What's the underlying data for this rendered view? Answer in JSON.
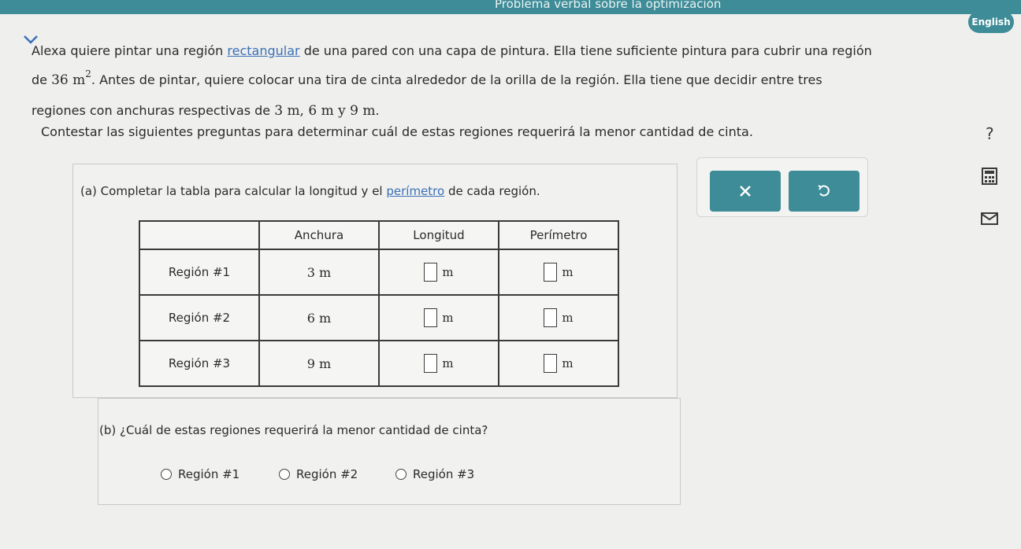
{
  "header": {
    "title": "Problema verbal sobre la optimización",
    "language_button": "English"
  },
  "problem": {
    "text1": "Alexa quiere pintar una región ",
    "link_rectangular": "rectangular",
    "text2": " de una pared con una capa de pintura. Ella tiene suficiente pintura para cubrir una región",
    "text3": "de ",
    "area_value": "36 m",
    "area_exponent": "2",
    "text4": ". Antes de pintar, quiere colocar una tira de cinta alrededor de la orilla de la región. Ella tiene que decidir entre tres",
    "text5": "regiones con anchuras respectivas de ",
    "widths": "3 m, 6 m y 9 m",
    "text6": "."
  },
  "instruction": "Contestar las siguientes preguntas para determinar cuál de estas regiones requerirá la menor cantidad de cinta.",
  "part_a": {
    "prefix": "(a) Completar la tabla para calcular la longitud y el ",
    "link_perimetro": "perímetro",
    "suffix": " de cada región."
  },
  "table": {
    "headers": [
      "",
      "Anchura",
      "Longitud",
      "Perímetro"
    ],
    "rows": [
      {
        "label": "Región #1",
        "width": "3 m",
        "length_unit": "m",
        "perimeter_unit": "m"
      },
      {
        "label": "Región #2",
        "width": "6 m",
        "length_unit": "m",
        "perimeter_unit": "m"
      },
      {
        "label": "Región #3",
        "width": "9 m",
        "length_unit": "m",
        "perimeter_unit": "m"
      }
    ]
  },
  "part_b": {
    "question": "(b) ¿Cuál de estas regiones requerirá la menor cantidad de cinta?",
    "options": [
      "Región #1",
      "Región #2",
      "Región #3"
    ]
  },
  "tools": {
    "clear_icon": "x-icon",
    "undo_icon": "undo-icon"
  },
  "icons": {
    "help": "?",
    "calculator": "calculator-icon",
    "mail": "envelope-icon"
  },
  "colors": {
    "accent": "#3e8c97",
    "link": "#3a6fb7"
  }
}
